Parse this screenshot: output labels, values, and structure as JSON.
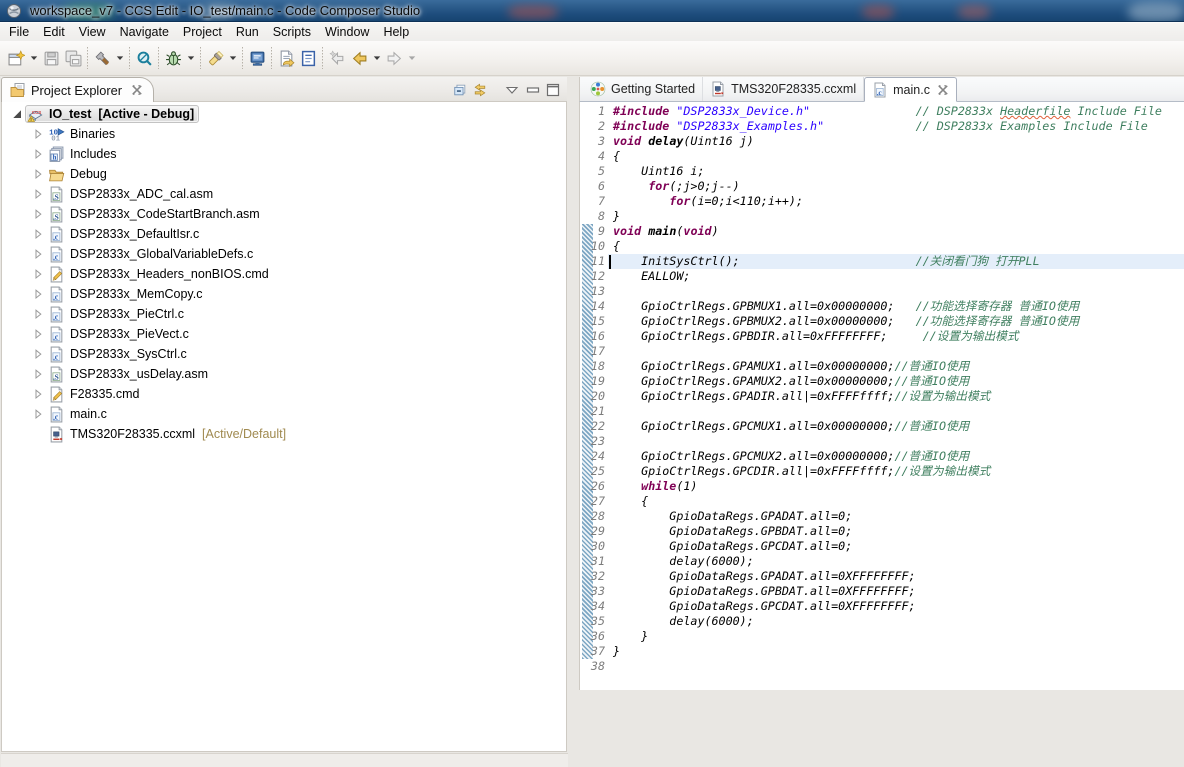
{
  "window": {
    "title": "workspace_v7 - CCS Edit - IO_test/main.c - Code Composer Studio"
  },
  "menu_bar": {
    "items": [
      "File",
      "Edit",
      "View",
      "Navigate",
      "Project",
      "Run",
      "Scripts",
      "Window",
      "Help"
    ]
  },
  "toolbar": {
    "groups": [
      [
        {
          "name": "new",
          "icon": "new-wizard-icon",
          "dropdown": true
        },
        {
          "name": "save",
          "icon": "save-icon",
          "disabled": true
        },
        {
          "name": "save-all",
          "icon": "save-all-icon",
          "disabled": true
        }
      ],
      [
        {
          "name": "build",
          "icon": "build-hammer-icon",
          "dropdown": true
        }
      ],
      [
        {
          "name": "inspect",
          "icon": "search-icon"
        }
      ],
      [
        {
          "name": "debug",
          "icon": "debug-bug-icon",
          "dropdown": true
        }
      ],
      [
        {
          "name": "flash",
          "icon": "flash-icon",
          "dropdown": true
        }
      ],
      [
        {
          "name": "target-console",
          "icon": "monitor-icon"
        }
      ],
      [
        {
          "name": "last-edit-location",
          "icon": "doc-arrow-icon"
        },
        {
          "name": "open-element",
          "icon": "blue-doc-icon"
        }
      ],
      [
        {
          "name": "back-to-start",
          "icon": "back-star-icon",
          "disabled": true
        },
        {
          "name": "back",
          "icon": "back-arrow-icon",
          "dropdown": true
        },
        {
          "name": "forward",
          "icon": "forward-arrow-icon",
          "disabled": true,
          "dropdown": true
        }
      ]
    ]
  },
  "project_explorer": {
    "tab_label": "Project Explorer",
    "buttons": [
      {
        "name": "collapse-all",
        "icon": "collapse-all-icon"
      },
      {
        "name": "link-with-editor",
        "icon": "link-editor-icon"
      },
      {
        "name": "view-menu",
        "icon": "view-menu-icon"
      },
      {
        "name": "minimize",
        "icon": "minimize-icon"
      },
      {
        "name": "maximize",
        "icon": "maximize-icon"
      }
    ],
    "tree": [
      {
        "depth": 0,
        "twisty": "expanded",
        "icon": "ccs-project-icon",
        "label": "IO_test",
        "suffix": " [Active - Debug]",
        "bold": true,
        "selected": true
      },
      {
        "depth": 1,
        "twisty": "collapsed",
        "icon": "binaries-icon",
        "label": "Binaries"
      },
      {
        "depth": 1,
        "twisty": "collapsed",
        "icon": "includes-icon",
        "label": "Includes"
      },
      {
        "depth": 1,
        "twisty": "collapsed",
        "icon": "debug-folder-icon",
        "label": "Debug"
      },
      {
        "depth": 1,
        "twisty": "collapsed",
        "icon": "asm-file-icon",
        "label": "DSP2833x_ADC_cal.asm"
      },
      {
        "depth": 1,
        "twisty": "collapsed",
        "icon": "asm-file-icon",
        "label": "DSP2833x_CodeStartBranch.asm"
      },
      {
        "depth": 1,
        "twisty": "collapsed",
        "icon": "c-file-icon",
        "label": "DSP2833x_DefaultIsr.c"
      },
      {
        "depth": 1,
        "twisty": "collapsed",
        "icon": "c-file-icon",
        "label": "DSP2833x_GlobalVariableDefs.c"
      },
      {
        "depth": 1,
        "twisty": "collapsed",
        "icon": "cmd-file-icon",
        "label": "DSP2833x_Headers_nonBIOS.cmd"
      },
      {
        "depth": 1,
        "twisty": "collapsed",
        "icon": "c-file-icon",
        "label": "DSP2833x_MemCopy.c"
      },
      {
        "depth": 1,
        "twisty": "collapsed",
        "icon": "c-file-icon",
        "label": "DSP2833x_PieCtrl.c"
      },
      {
        "depth": 1,
        "twisty": "collapsed",
        "icon": "c-file-icon",
        "label": "DSP2833x_PieVect.c"
      },
      {
        "depth": 1,
        "twisty": "collapsed",
        "icon": "c-file-icon",
        "label": "DSP2833x_SysCtrl.c"
      },
      {
        "depth": 1,
        "twisty": "collapsed",
        "icon": "asm-file-icon",
        "label": "DSP2833x_usDelay.asm"
      },
      {
        "depth": 1,
        "twisty": "collapsed",
        "icon": "cmd-file-icon",
        "label": "F28335.cmd"
      },
      {
        "depth": 1,
        "twisty": "collapsed",
        "icon": "c-file-icon",
        "label": "main.c"
      },
      {
        "depth": 1,
        "twisty": "none",
        "icon": "ccxml-file-icon",
        "label": "TMS320F28335.ccxml",
        "suffix": " [Active/Default]",
        "suffix_decorated": true
      }
    ]
  },
  "editor": {
    "tabs": [
      {
        "label": "Getting Started",
        "icon": "getting-started-icon",
        "active": false
      },
      {
        "label": "TMS320F28335.ccxml",
        "icon": "ccxml-file-icon",
        "active": false
      },
      {
        "label": "main.c",
        "icon": "c-file-icon",
        "active": true,
        "closable": true
      }
    ],
    "current_line": 11,
    "caret": {
      "line": 11,
      "column": 0
    },
    "range_indicator": {
      "from_line": 9,
      "to_line": 37
    },
    "lines": [
      {
        "n": 1,
        "seg": [
          [
            "k",
            "#include"
          ],
          [
            "p",
            " "
          ],
          [
            "s",
            "\"DSP2833x_Device.h\""
          ],
          [
            "p",
            "               "
          ],
          [
            "c",
            "// DSP2833x "
          ],
          [
            "cm",
            "Headerfile"
          ],
          [
            "c",
            " Include File"
          ]
        ]
      },
      {
        "n": 2,
        "seg": [
          [
            "k",
            "#include"
          ],
          [
            "p",
            " "
          ],
          [
            "s",
            "\"DSP2833x_Examples.h\""
          ],
          [
            "p",
            "             "
          ],
          [
            "c",
            "// DSP2833x Examples Include File"
          ]
        ]
      },
      {
        "n": 3,
        "seg": [
          [
            "k",
            "void"
          ],
          [
            "p",
            " "
          ],
          [
            "f",
            "delay"
          ],
          [
            "p",
            "(Uint16 j)"
          ]
        ]
      },
      {
        "n": 4,
        "seg": [
          [
            "p",
            "{"
          ]
        ]
      },
      {
        "n": 5,
        "seg": [
          [
            "p",
            "    Uint16 i;"
          ]
        ]
      },
      {
        "n": 6,
        "seg": [
          [
            "p",
            "     "
          ],
          [
            "k",
            "for"
          ],
          [
            "p",
            "(;j>0;j--)"
          ]
        ]
      },
      {
        "n": 7,
        "seg": [
          [
            "p",
            "        "
          ],
          [
            "k",
            "for"
          ],
          [
            "p",
            "(i=0;i<110;i++);"
          ]
        ]
      },
      {
        "n": 8,
        "seg": [
          [
            "p",
            "}"
          ]
        ]
      },
      {
        "n": 9,
        "seg": [
          [
            "k",
            "void"
          ],
          [
            "p",
            " "
          ],
          [
            "f",
            "main"
          ],
          [
            "p",
            "("
          ],
          [
            "k",
            "void"
          ],
          [
            "p",
            ")"
          ]
        ]
      },
      {
        "n": 10,
        "seg": [
          [
            "p",
            "{"
          ]
        ]
      },
      {
        "n": 11,
        "seg": [
          [
            "p",
            "    InitSysCtrl();"
          ],
          [
            "p",
            "                         "
          ],
          [
            "c",
            "//关闭看门狗 打开PLL"
          ]
        ]
      },
      {
        "n": 12,
        "seg": [
          [
            "p",
            "    EALLOW;"
          ]
        ]
      },
      {
        "n": 13,
        "seg": []
      },
      {
        "n": 14,
        "seg": [
          [
            "p",
            "    GpioCtrlRegs.GPBMUX1.all=0x00000000;"
          ],
          [
            "p",
            "   "
          ],
          [
            "c",
            "//功能选择寄存器 普通IO使用"
          ]
        ]
      },
      {
        "n": 15,
        "seg": [
          [
            "p",
            "    GpioCtrlRegs.GPBMUX2.all=0x00000000;"
          ],
          [
            "p",
            "   "
          ],
          [
            "c",
            "//功能选择寄存器 普通IO使用"
          ]
        ]
      },
      {
        "n": 16,
        "seg": [
          [
            "p",
            "    GpioCtrlRegs.GPBDIR.all=0xFFFFFFFF;"
          ],
          [
            "p",
            "     "
          ],
          [
            "c",
            "//设置为输出模式"
          ]
        ]
      },
      {
        "n": 17,
        "seg": []
      },
      {
        "n": 18,
        "seg": [
          [
            "p",
            "    GpioCtrlRegs.GPAMUX1.all=0x00000000;"
          ],
          [
            "c",
            "//普通IO使用"
          ]
        ]
      },
      {
        "n": 19,
        "seg": [
          [
            "p",
            "    GpioCtrlRegs.GPAMUX2.all=0x00000000;"
          ],
          [
            "c",
            "//普通IO使用"
          ]
        ]
      },
      {
        "n": 20,
        "seg": [
          [
            "p",
            "    GpioCtrlRegs.GPADIR.all|=0xFFFFffff;"
          ],
          [
            "c",
            "//设置为输出模式"
          ]
        ]
      },
      {
        "n": 21,
        "seg": []
      },
      {
        "n": 22,
        "seg": [
          [
            "p",
            "    GpioCtrlRegs.GPCMUX1.all=0x00000000;"
          ],
          [
            "c",
            "//普通IO使用"
          ]
        ]
      },
      {
        "n": 23,
        "seg": []
      },
      {
        "n": 24,
        "seg": [
          [
            "p",
            "    GpioCtrlRegs.GPCMUX2.all=0x00000000;"
          ],
          [
            "c",
            "//普通IO使用"
          ]
        ]
      },
      {
        "n": 25,
        "seg": [
          [
            "p",
            "    GpioCtrlRegs.GPCDIR.all|=0xFFFFffff;"
          ],
          [
            "c",
            "//设置为输出模式"
          ]
        ]
      },
      {
        "n": 26,
        "seg": [
          [
            "p",
            "    "
          ],
          [
            "k",
            "while"
          ],
          [
            "p",
            "(1)"
          ]
        ]
      },
      {
        "n": 27,
        "seg": [
          [
            "p",
            "    {"
          ]
        ]
      },
      {
        "n": 28,
        "seg": [
          [
            "p",
            "        GpioDataRegs.GPADAT.all=0;"
          ]
        ]
      },
      {
        "n": 29,
        "seg": [
          [
            "p",
            "        GpioDataRegs.GPBDAT.all=0;"
          ]
        ]
      },
      {
        "n": 30,
        "seg": [
          [
            "p",
            "        GpioDataRegs.GPCDAT.all=0;"
          ]
        ]
      },
      {
        "n": 31,
        "seg": [
          [
            "p",
            "        delay(6000);"
          ]
        ]
      },
      {
        "n": 32,
        "seg": [
          [
            "p",
            "        GpioDataRegs.GPADAT.all=0XFFFFFFFF;"
          ]
        ]
      },
      {
        "n": 33,
        "seg": [
          [
            "p",
            "        GpioDataRegs.GPBDAT.all=0XFFFFFFFF;"
          ]
        ]
      },
      {
        "n": 34,
        "seg": [
          [
            "p",
            "        GpioDataRegs.GPCDAT.all=0XFFFFFFFF;"
          ]
        ]
      },
      {
        "n": 35,
        "seg": [
          [
            "p",
            "        delay(6000);"
          ]
        ]
      },
      {
        "n": 36,
        "seg": [
          [
            "p",
            "    }"
          ]
        ]
      },
      {
        "n": 37,
        "seg": [
          [
            "p",
            "}"
          ]
        ]
      },
      {
        "n": 38,
        "seg": []
      }
    ]
  },
  "colors": {
    "keyword": "#7f0055",
    "string": "#2a00ff",
    "comment": "#3f7f5f",
    "plain": "#000000",
    "line_number": "#7d7d7d",
    "current_line_bg": "#e4eefa",
    "decorator_text": "#a08a50",
    "titlebar_blue": "#2b5b8a",
    "squiggle": "#e0603a"
  }
}
